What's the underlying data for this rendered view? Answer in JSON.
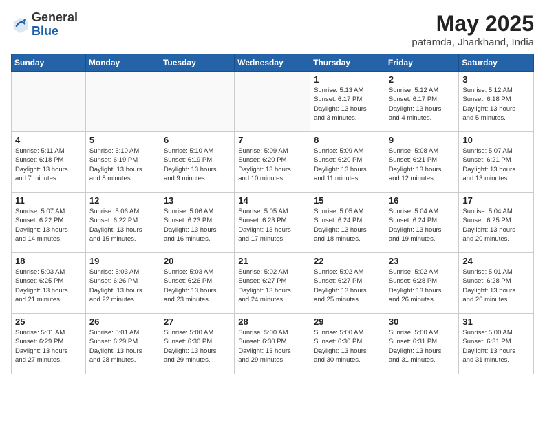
{
  "header": {
    "logo_general": "General",
    "logo_blue": "Blue",
    "month_year": "May 2025",
    "location": "patamda, Jharkhand, India"
  },
  "weekdays": [
    "Sunday",
    "Monday",
    "Tuesday",
    "Wednesday",
    "Thursday",
    "Friday",
    "Saturday"
  ],
  "weeks": [
    [
      {
        "day": "",
        "info": ""
      },
      {
        "day": "",
        "info": ""
      },
      {
        "day": "",
        "info": ""
      },
      {
        "day": "",
        "info": ""
      },
      {
        "day": "1",
        "info": "Sunrise: 5:13 AM\nSunset: 6:17 PM\nDaylight: 13 hours\nand 3 minutes."
      },
      {
        "day": "2",
        "info": "Sunrise: 5:12 AM\nSunset: 6:17 PM\nDaylight: 13 hours\nand 4 minutes."
      },
      {
        "day": "3",
        "info": "Sunrise: 5:12 AM\nSunset: 6:18 PM\nDaylight: 13 hours\nand 5 minutes."
      }
    ],
    [
      {
        "day": "4",
        "info": "Sunrise: 5:11 AM\nSunset: 6:18 PM\nDaylight: 13 hours\nand 7 minutes."
      },
      {
        "day": "5",
        "info": "Sunrise: 5:10 AM\nSunset: 6:19 PM\nDaylight: 13 hours\nand 8 minutes."
      },
      {
        "day": "6",
        "info": "Sunrise: 5:10 AM\nSunset: 6:19 PM\nDaylight: 13 hours\nand 9 minutes."
      },
      {
        "day": "7",
        "info": "Sunrise: 5:09 AM\nSunset: 6:20 PM\nDaylight: 13 hours\nand 10 minutes."
      },
      {
        "day": "8",
        "info": "Sunrise: 5:09 AM\nSunset: 6:20 PM\nDaylight: 13 hours\nand 11 minutes."
      },
      {
        "day": "9",
        "info": "Sunrise: 5:08 AM\nSunset: 6:21 PM\nDaylight: 13 hours\nand 12 minutes."
      },
      {
        "day": "10",
        "info": "Sunrise: 5:07 AM\nSunset: 6:21 PM\nDaylight: 13 hours\nand 13 minutes."
      }
    ],
    [
      {
        "day": "11",
        "info": "Sunrise: 5:07 AM\nSunset: 6:22 PM\nDaylight: 13 hours\nand 14 minutes."
      },
      {
        "day": "12",
        "info": "Sunrise: 5:06 AM\nSunset: 6:22 PM\nDaylight: 13 hours\nand 15 minutes."
      },
      {
        "day": "13",
        "info": "Sunrise: 5:06 AM\nSunset: 6:23 PM\nDaylight: 13 hours\nand 16 minutes."
      },
      {
        "day": "14",
        "info": "Sunrise: 5:05 AM\nSunset: 6:23 PM\nDaylight: 13 hours\nand 17 minutes."
      },
      {
        "day": "15",
        "info": "Sunrise: 5:05 AM\nSunset: 6:24 PM\nDaylight: 13 hours\nand 18 minutes."
      },
      {
        "day": "16",
        "info": "Sunrise: 5:04 AM\nSunset: 6:24 PM\nDaylight: 13 hours\nand 19 minutes."
      },
      {
        "day": "17",
        "info": "Sunrise: 5:04 AM\nSunset: 6:25 PM\nDaylight: 13 hours\nand 20 minutes."
      }
    ],
    [
      {
        "day": "18",
        "info": "Sunrise: 5:03 AM\nSunset: 6:25 PM\nDaylight: 13 hours\nand 21 minutes."
      },
      {
        "day": "19",
        "info": "Sunrise: 5:03 AM\nSunset: 6:26 PM\nDaylight: 13 hours\nand 22 minutes."
      },
      {
        "day": "20",
        "info": "Sunrise: 5:03 AM\nSunset: 6:26 PM\nDaylight: 13 hours\nand 23 minutes."
      },
      {
        "day": "21",
        "info": "Sunrise: 5:02 AM\nSunset: 6:27 PM\nDaylight: 13 hours\nand 24 minutes."
      },
      {
        "day": "22",
        "info": "Sunrise: 5:02 AM\nSunset: 6:27 PM\nDaylight: 13 hours\nand 25 minutes."
      },
      {
        "day": "23",
        "info": "Sunrise: 5:02 AM\nSunset: 6:28 PM\nDaylight: 13 hours\nand 26 minutes."
      },
      {
        "day": "24",
        "info": "Sunrise: 5:01 AM\nSunset: 6:28 PM\nDaylight: 13 hours\nand 26 minutes."
      }
    ],
    [
      {
        "day": "25",
        "info": "Sunrise: 5:01 AM\nSunset: 6:29 PM\nDaylight: 13 hours\nand 27 minutes."
      },
      {
        "day": "26",
        "info": "Sunrise: 5:01 AM\nSunset: 6:29 PM\nDaylight: 13 hours\nand 28 minutes."
      },
      {
        "day": "27",
        "info": "Sunrise: 5:00 AM\nSunset: 6:30 PM\nDaylight: 13 hours\nand 29 minutes."
      },
      {
        "day": "28",
        "info": "Sunrise: 5:00 AM\nSunset: 6:30 PM\nDaylight: 13 hours\nand 29 minutes."
      },
      {
        "day": "29",
        "info": "Sunrise: 5:00 AM\nSunset: 6:30 PM\nDaylight: 13 hours\nand 30 minutes."
      },
      {
        "day": "30",
        "info": "Sunrise: 5:00 AM\nSunset: 6:31 PM\nDaylight: 13 hours\nand 31 minutes."
      },
      {
        "day": "31",
        "info": "Sunrise: 5:00 AM\nSunset: 6:31 PM\nDaylight: 13 hours\nand 31 minutes."
      }
    ]
  ]
}
